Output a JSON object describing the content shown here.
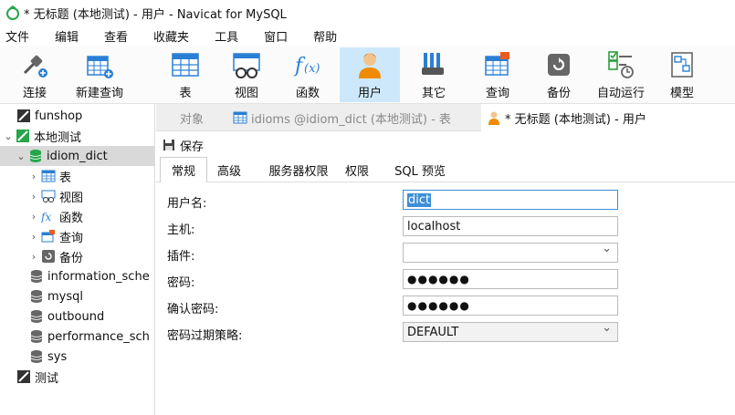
{
  "window": {
    "title": "* 无标题 (本地测试) - 用户 - Navicat for MySQL"
  },
  "menu": [
    "文件",
    "编辑",
    "查看",
    "收藏夹",
    "工具",
    "窗口",
    "帮助"
  ],
  "toolbar": {
    "items": [
      {
        "label": "连接",
        "icon": "connection-icon"
      },
      {
        "label": "新建查询",
        "icon": "new-query-icon"
      },
      {
        "label": "表",
        "icon": "table-icon"
      },
      {
        "label": "视图",
        "icon": "view-icon"
      },
      {
        "label": "函数",
        "icon": "function-icon"
      },
      {
        "label": "用户",
        "icon": "user-icon",
        "active": true
      },
      {
        "label": "其它",
        "icon": "tools-icon"
      },
      {
        "label": "查询",
        "icon": "query-icon"
      },
      {
        "label": "备份",
        "icon": "backup-icon"
      },
      {
        "label": "自动运行",
        "icon": "automation-icon"
      },
      {
        "label": "模型",
        "icon": "model-icon"
      }
    ]
  },
  "sidebar": {
    "items": [
      {
        "label": "funshop",
        "icon": "connection-icon"
      },
      {
        "label": "本地测试",
        "icon": "connection-icon"
      },
      {
        "label": "idiom_dict",
        "icon": "database-icon"
      },
      {
        "label": "表",
        "icon": "table-icon"
      },
      {
        "label": "视图",
        "icon": "view-icon"
      },
      {
        "label": "函数",
        "icon": "function-icon"
      },
      {
        "label": "查询",
        "icon": "query-icon"
      },
      {
        "label": "备份",
        "icon": "backup-icon"
      },
      {
        "label": "information_sche",
        "icon": "database-icon"
      },
      {
        "label": "mysql",
        "icon": "database-icon"
      },
      {
        "label": "outbound",
        "icon": "database-icon"
      },
      {
        "label": "performance_sch",
        "icon": "database-icon"
      },
      {
        "label": "sys",
        "icon": "database-icon"
      },
      {
        "label": "测试",
        "icon": "connection-icon"
      }
    ]
  },
  "tabs": [
    {
      "label": "对象"
    },
    {
      "label": "idioms @idiom_dict (本地测试) - 表"
    },
    {
      "label": "* 无标题 (本地测试) - 用户"
    }
  ],
  "editor": {
    "save_label": "保存",
    "subtabs": [
      "常规",
      "高级",
      "服务器权限",
      "权限",
      "SQL 预览"
    ],
    "fields": [
      {
        "label": "用户名:",
        "value": "dict"
      },
      {
        "label": "主机:",
        "value": "localhost"
      },
      {
        "label": "插件:",
        "value": ""
      },
      {
        "label": "密码:",
        "value": "●●●●●●"
      },
      {
        "label": "确认密码:",
        "value": "●●●●●●"
      },
      {
        "label": "密码过期策略:",
        "value": "DEFAULT"
      }
    ]
  },
  "colors": {
    "accent": "#3c8fd8",
    "active_tool": "#cde8fb",
    "selected_row": "#d9d9d9",
    "brand_green": "#27a74a"
  }
}
